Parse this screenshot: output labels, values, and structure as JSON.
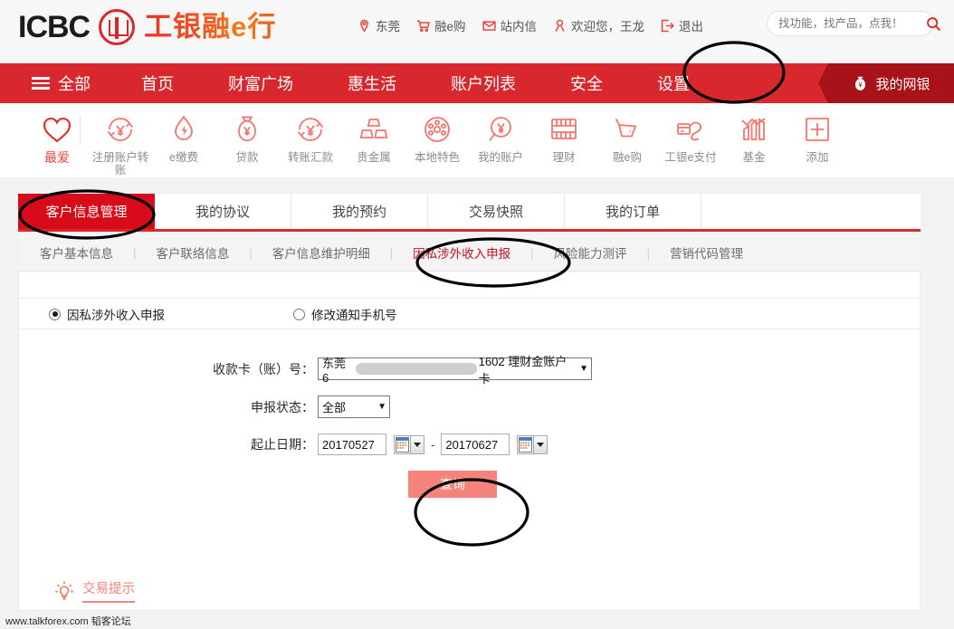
{
  "header": {
    "logo_text": "ICBC",
    "logo_cn": "工银融e行",
    "links": [
      {
        "icon": "location-pin-icon",
        "label": "东莞"
      },
      {
        "icon": "shopping-cart-icon",
        "label": "融e购"
      },
      {
        "icon": "envelope-icon",
        "label": "站内信"
      },
      {
        "icon": "user-icon",
        "label": "欢迎您，王龙"
      },
      {
        "icon": "logout-icon",
        "label": "退出"
      }
    ],
    "search": {
      "placeholder": "找功能，找产品，点我！",
      "value": "",
      "icon": "search-icon"
    }
  },
  "nav": {
    "all_label": "全部",
    "items": [
      "首页",
      "财富广场",
      "惠生活",
      "账户列表",
      "安全",
      "设置"
    ],
    "active_item": "设置",
    "ribbon": {
      "label": "我的网银",
      "icon": "money-bag-icon"
    }
  },
  "quicklinks": [
    {
      "label": "最爱",
      "icon": "heart-icon",
      "active": true
    },
    {
      "label": "注册账户转账",
      "icon": "transfer-yuan-icon",
      "active": false
    },
    {
      "label": "e缴费",
      "icon": "water-drop-bolt-icon",
      "active": false
    },
    {
      "label": "贷款",
      "icon": "money-bag-yuan-icon",
      "active": false
    },
    {
      "label": "转账汇款",
      "icon": "transfer-yuan-icon",
      "active": false
    },
    {
      "label": "贵金属",
      "icon": "gold-bars-icon",
      "active": false
    },
    {
      "label": "本地特色",
      "icon": "film-reel-icon",
      "active": false
    },
    {
      "label": "我的账户",
      "icon": "yuan-magnifier-icon",
      "active": false
    },
    {
      "label": "理财",
      "icon": "abacus-icon",
      "active": false
    },
    {
      "label": "融e购",
      "icon": "shopping-cart-icon",
      "active": false
    },
    {
      "label": "工银e支付",
      "icon": "e-pay-icon",
      "active": false
    },
    {
      "label": "基金",
      "icon": "bar-chart-icon",
      "active": false
    },
    {
      "label": "添加",
      "icon": "plus-square-icon",
      "active": false
    }
  ],
  "tabs": [
    {
      "label": "客户信息管理",
      "active": true
    },
    {
      "label": "我的协议",
      "active": false
    },
    {
      "label": "我的预约",
      "active": false
    },
    {
      "label": "交易快照",
      "active": false
    },
    {
      "label": "我的订单",
      "active": false
    }
  ],
  "subtabs": [
    {
      "label": "客户基本信息",
      "active": false
    },
    {
      "label": "客户联络信息",
      "active": false
    },
    {
      "label": "客户信息维护明细",
      "active": false
    },
    {
      "label": "因私涉外收入申报",
      "active": true
    },
    {
      "label": "风险能力测评",
      "active": false
    },
    {
      "label": "营销代码管理",
      "active": false
    }
  ],
  "radios": [
    {
      "label": "因私涉外收入申报",
      "selected": true
    },
    {
      "label": "修改通知手机号",
      "selected": false
    }
  ],
  "form": {
    "card_label": "收款卡（账）号：",
    "card_prefix": "东莞 6",
    "card_suffix": "1602 理财金账户卡",
    "status_label": "申报状态：",
    "status_value": "全部",
    "status_options": [
      "全部"
    ],
    "date_label": "起止日期：",
    "date_from": "20170527",
    "date_to": "20170627",
    "date_separator": "-",
    "calendar_icon": "calendar-icon",
    "query_button": "查询"
  },
  "tip": {
    "icon": "lightbulb-icon",
    "label": "交易提示"
  },
  "watermark": "www.talkforex.com 韬客论坛",
  "colors": {
    "brand_red": "#d9272e",
    "nav_active_red": "#d70b19",
    "ribbon_red": "#a81219",
    "salmon": "#f4837c",
    "icon_pink": "#f4756e",
    "page_bg": "#f2f2f2"
  },
  "annotations": [
    {
      "name": "settings-nav-highlight",
      "target": "设置"
    },
    {
      "name": "customer-info-tab-highlight",
      "target": "客户信息管理"
    },
    {
      "name": "foreign-income-subtab-highlight",
      "target": "因私涉外收入申报"
    },
    {
      "name": "query-button-highlight",
      "target": "查询"
    }
  ]
}
